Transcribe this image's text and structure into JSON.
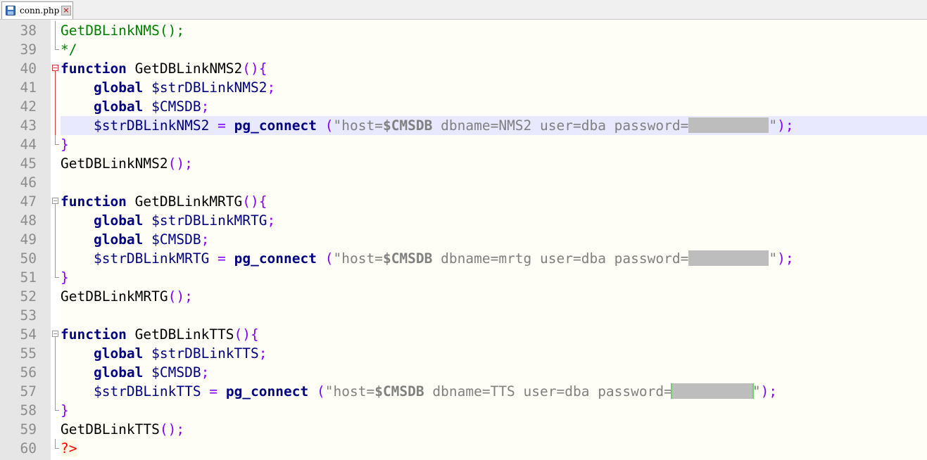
{
  "tab": {
    "filename": "conn.php",
    "icon": "save-icon",
    "close": "close-icon"
  },
  "editor": {
    "current_line": 43,
    "lines": [
      {
        "n": "38",
        "fold": "line",
        "tokens": [
          [
            "cmt",
            "GetDBLinkNMS();"
          ]
        ]
      },
      {
        "n": "39",
        "fold": "end",
        "tokens": [
          [
            "cmt",
            "*/"
          ]
        ]
      },
      {
        "n": "40",
        "fold": "open-red",
        "tokens": [
          [
            "kw",
            "function"
          ],
          [
            "fn",
            " GetDBLinkNMS2"
          ],
          [
            "op",
            "(){"
          ]
        ]
      },
      {
        "n": "41",
        "fold": "red",
        "tokens": [
          [
            "fn",
            "    "
          ],
          [
            "kw",
            "global"
          ],
          [
            "var",
            " $strDBLinkNMS2"
          ],
          [
            "op",
            ";"
          ]
        ]
      },
      {
        "n": "42",
        "fold": "red",
        "tokens": [
          [
            "fn",
            "    "
          ],
          [
            "kw",
            "global"
          ],
          [
            "var",
            " $CMSDB"
          ],
          [
            "op",
            ";"
          ]
        ]
      },
      {
        "n": "43",
        "fold": "red",
        "tokens": [
          [
            "fn",
            "    "
          ],
          [
            "var",
            "$strDBLinkNMS2"
          ],
          [
            "fn",
            " "
          ],
          [
            "op",
            "="
          ],
          [
            "fn",
            " "
          ],
          [
            "kw",
            "pg_connect"
          ],
          [
            "fn",
            " "
          ],
          [
            "op",
            "("
          ],
          [
            "str",
            "\"host="
          ],
          [
            "strb",
            "$CMSDB"
          ],
          [
            "str",
            " dbname=NMS2 user=dba password="
          ],
          [
            "redact",
            ""
          ],
          [
            "str",
            "\""
          ],
          [
            "op",
            ");"
          ]
        ]
      },
      {
        "n": "44",
        "fold": "end",
        "tokens": [
          [
            "op",
            "}"
          ]
        ]
      },
      {
        "n": "45",
        "fold": "none",
        "tokens": [
          [
            "fn",
            "GetDBLinkNMS2"
          ],
          [
            "op",
            "();"
          ]
        ]
      },
      {
        "n": "46",
        "fold": "none",
        "tokens": []
      },
      {
        "n": "47",
        "fold": "open",
        "tokens": [
          [
            "kw",
            "function"
          ],
          [
            "fn",
            " GetDBLinkMRTG"
          ],
          [
            "op",
            "(){"
          ]
        ]
      },
      {
        "n": "48",
        "fold": "line",
        "tokens": [
          [
            "fn",
            "    "
          ],
          [
            "kw",
            "global"
          ],
          [
            "var",
            " $strDBLinkMRTG"
          ],
          [
            "op",
            ";"
          ]
        ]
      },
      {
        "n": "49",
        "fold": "line",
        "tokens": [
          [
            "fn",
            "    "
          ],
          [
            "kw",
            "global"
          ],
          [
            "var",
            " $CMSDB"
          ],
          [
            "op",
            ";"
          ]
        ]
      },
      {
        "n": "50",
        "fold": "line",
        "tokens": [
          [
            "fn",
            "    "
          ],
          [
            "var",
            "$strDBLinkMRTG"
          ],
          [
            "fn",
            " "
          ],
          [
            "op",
            "="
          ],
          [
            "fn",
            " "
          ],
          [
            "kw",
            "pg_connect"
          ],
          [
            "fn",
            " "
          ],
          [
            "op",
            "("
          ],
          [
            "str",
            "\"host="
          ],
          [
            "strb",
            "$CMSDB"
          ],
          [
            "str",
            " dbname=mrtg user=dba password="
          ],
          [
            "redact",
            ""
          ],
          [
            "str",
            "\""
          ],
          [
            "op",
            ");"
          ]
        ]
      },
      {
        "n": "51",
        "fold": "end",
        "tokens": [
          [
            "op",
            "}"
          ]
        ]
      },
      {
        "n": "52",
        "fold": "none",
        "tokens": [
          [
            "fn",
            "GetDBLinkMRTG"
          ],
          [
            "op",
            "();"
          ]
        ]
      },
      {
        "n": "53",
        "fold": "none",
        "tokens": []
      },
      {
        "n": "54",
        "fold": "open",
        "tokens": [
          [
            "kw",
            "function"
          ],
          [
            "fn",
            " GetDBLinkTTS"
          ],
          [
            "op",
            "(){"
          ]
        ]
      },
      {
        "n": "55",
        "fold": "line",
        "tokens": [
          [
            "fn",
            "    "
          ],
          [
            "kw",
            "global"
          ],
          [
            "var",
            " $strDBLinkTTS"
          ],
          [
            "op",
            ";"
          ]
        ]
      },
      {
        "n": "56",
        "fold": "line",
        "tokens": [
          [
            "fn",
            "    "
          ],
          [
            "kw",
            "global"
          ],
          [
            "var",
            " $CMSDB"
          ],
          [
            "op",
            ";"
          ]
        ]
      },
      {
        "n": "57",
        "fold": "line",
        "tokens": [
          [
            "fn",
            "    "
          ],
          [
            "var",
            "$strDBLinkTTS"
          ],
          [
            "fn",
            " "
          ],
          [
            "op",
            "="
          ],
          [
            "fn",
            " "
          ],
          [
            "kw",
            "pg_connect"
          ],
          [
            "fn",
            " "
          ],
          [
            "op",
            "("
          ],
          [
            "str",
            "\"host="
          ],
          [
            "strb",
            "$CMSDB"
          ],
          [
            "str",
            " dbname=TTS user=dba password="
          ],
          [
            "redact-green",
            ""
          ],
          [
            "str",
            "\""
          ],
          [
            "op",
            ");"
          ]
        ]
      },
      {
        "n": "58",
        "fold": "end",
        "tokens": [
          [
            "op",
            "}"
          ]
        ]
      },
      {
        "n": "59",
        "fold": "none",
        "tokens": [
          [
            "fn",
            "GetDBLinkTTS"
          ],
          [
            "op",
            "();"
          ]
        ]
      },
      {
        "n": "60",
        "fold": "end",
        "tokens": [
          [
            "php",
            "?>"
          ]
        ]
      }
    ]
  }
}
